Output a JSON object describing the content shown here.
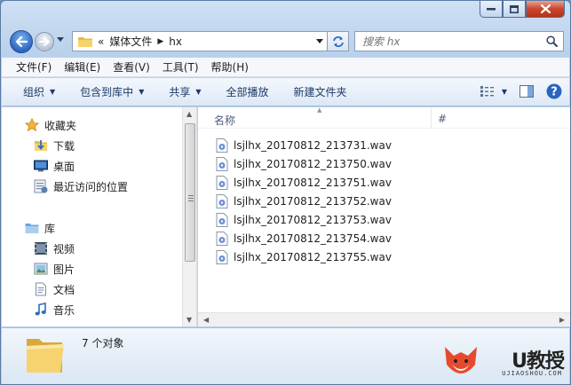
{
  "window": {
    "caption": {
      "minimize": "minimize",
      "maximize": "maximize",
      "close": "close"
    }
  },
  "address": {
    "overflow": "«",
    "segments": [
      "媒体文件",
      "hx"
    ]
  },
  "search": {
    "placeholder": "搜索 hx"
  },
  "menu": {
    "items": [
      "文件(F)",
      "编辑(E)",
      "查看(V)",
      "工具(T)",
      "帮助(H)"
    ]
  },
  "toolbar": {
    "organize": "组织",
    "include_library": "包含到库中",
    "share": "共享",
    "play_all": "全部播放",
    "new_folder": "新建文件夹"
  },
  "nav": {
    "favorites": "收藏夹",
    "downloads": "下载",
    "desktop": "桌面",
    "recent": "最近访问的位置",
    "libraries": "库",
    "videos": "视频",
    "pictures": "图片",
    "documents": "文档",
    "music": "音乐"
  },
  "columns": {
    "name": "名称",
    "number": "#"
  },
  "files": [
    "lsjlhx_20170812_213731.wav",
    "lsjlhx_20170812_213750.wav",
    "lsjlhx_20170812_213751.wav",
    "lsjlhx_20170812_213752.wav",
    "lsjlhx_20170812_213753.wav",
    "lsjlhx_20170812_213754.wav",
    "lsjlhx_20170812_213755.wav"
  ],
  "details": {
    "count": "7 个对象"
  },
  "watermark": {
    "text": "U教授",
    "sub": "UJIAOSHOU.COM"
  },
  "colors": {
    "accent": "#2c66c3",
    "close": "#c9462c",
    "folder": "#f0c95a"
  }
}
